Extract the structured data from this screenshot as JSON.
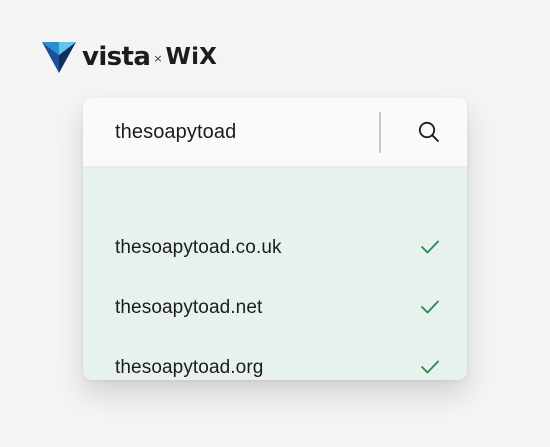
{
  "brand": {
    "primary": "vista",
    "separator": "×",
    "partner": "WiX",
    "mark_colors": [
      "#1d4e96",
      "#2a8fd0",
      "#66c2ee",
      "#0e2f5c"
    ]
  },
  "search": {
    "value": "thesoapytoad",
    "icon": "search-icon"
  },
  "results": [
    {
      "domain": "thesoapytoad.co.uk",
      "status_icon": "check-icon"
    },
    {
      "domain": "thesoapytoad.net",
      "status_icon": "check-icon"
    },
    {
      "domain": "thesoapytoad.org",
      "status_icon": "check-icon"
    }
  ],
  "colors": {
    "page_background": "#f4f4f4",
    "results_background": "#e7f2ef",
    "search_background": "#fafafa",
    "check": "#2a8a4a"
  }
}
